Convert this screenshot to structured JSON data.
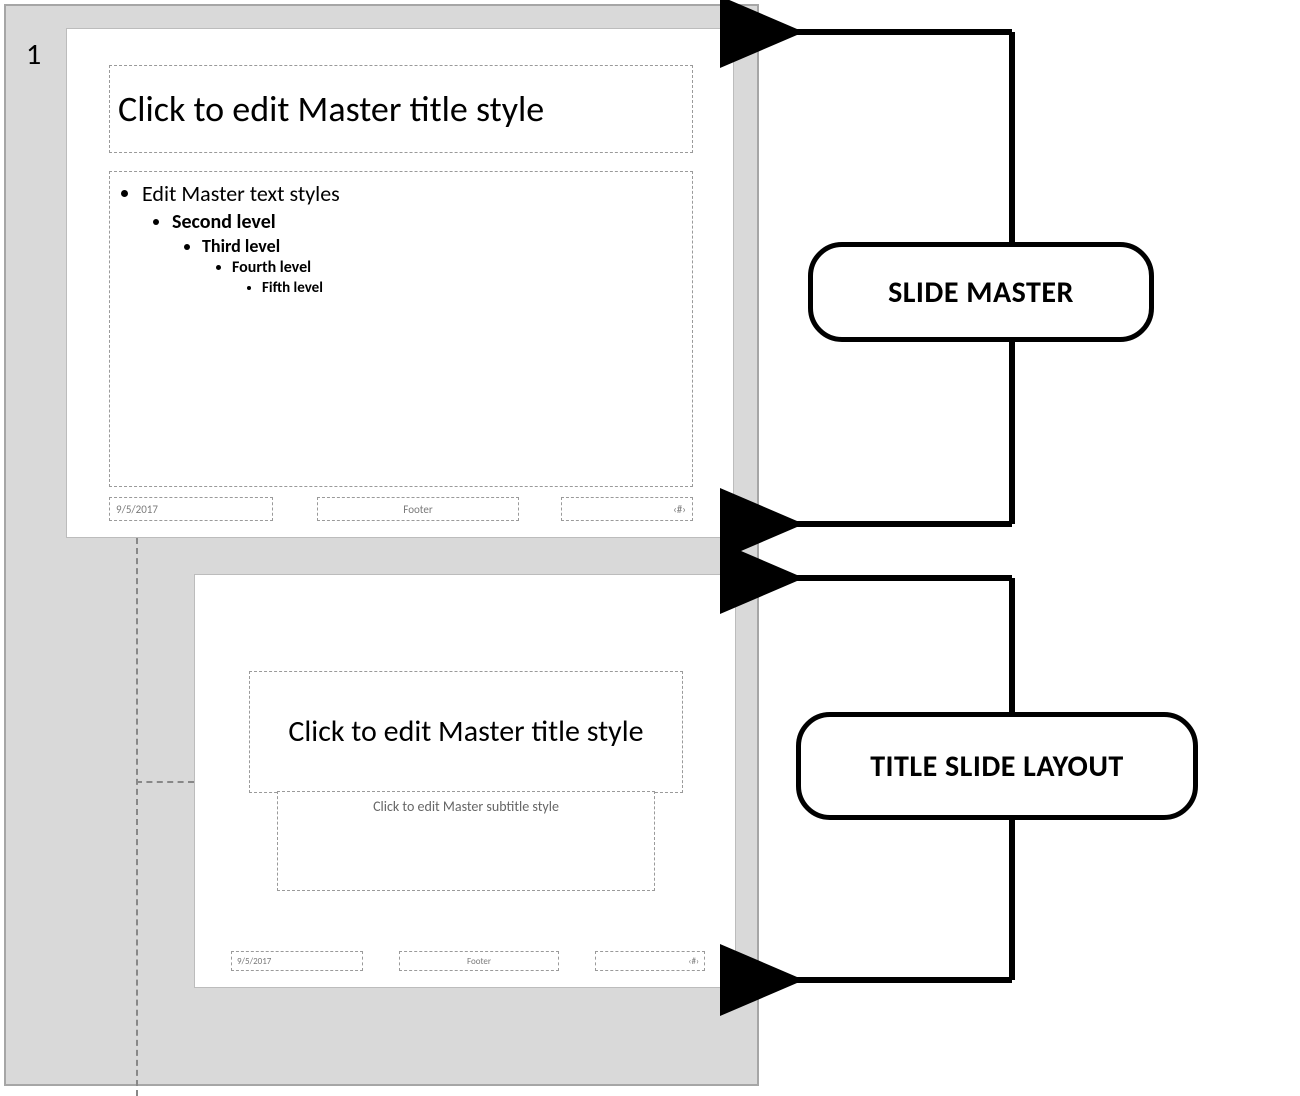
{
  "index": "1",
  "master": {
    "title": "Click to edit Master title style",
    "levels": {
      "l1": "Edit Master text styles",
      "l2": "Second level",
      "l3": "Third level",
      "l4": "Fourth level",
      "l5": "Fifth level"
    },
    "date": "9/5/2017",
    "footer": "Footer",
    "page": "‹#›"
  },
  "layout": {
    "title": "Click to edit Master title style",
    "subtitle": "Click to edit Master subtitle style",
    "date": "9/5/2017",
    "footer": "Footer",
    "page": "‹#›"
  },
  "callouts": {
    "master": "SLIDE MASTER",
    "layout": "TITLE SLIDE LAYOUT"
  }
}
